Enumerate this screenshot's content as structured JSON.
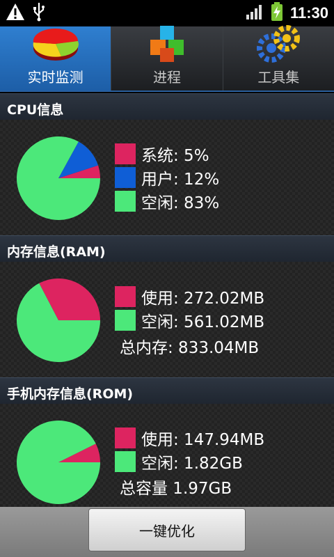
{
  "status_bar": {
    "time": "11:30",
    "icons": [
      "warning-icon",
      "usb-icon",
      "signal-icon",
      "battery-charging-icon"
    ]
  },
  "tabs": [
    {
      "label": "实时监测",
      "icon": "pie-chart-icon",
      "active": true
    },
    {
      "label": "进程",
      "icon": "cubes-icon",
      "active": false
    },
    {
      "label": "工具集",
      "icon": "gears-icon",
      "active": false
    }
  ],
  "cpu": {
    "title": "CPU信息",
    "items": [
      {
        "label": "系统: 5%",
        "color": "#dd2460",
        "value": 5
      },
      {
        "label": "用户: 12%",
        "color": "#0f5ed6",
        "value": 12
      },
      {
        "label": "空闲: 83%",
        "color": "#4ce87a",
        "value": 83
      }
    ]
  },
  "ram": {
    "title": "内存信息(RAM)",
    "items": [
      {
        "label": "使用: 272.02MB",
        "color": "#dd2460",
        "value": 272.02
      },
      {
        "label": "空闲: 561.02MB",
        "color": "#4ce87a",
        "value": 561.02
      }
    ],
    "total": "总内存: 833.04MB"
  },
  "rom": {
    "title": "手机内存信息(ROM)",
    "items": [
      {
        "label": "使用: 147.94MB",
        "color": "#dd2460",
        "value": 147.94
      },
      {
        "label": "空闲: 1.82GB",
        "color": "#4ce87a",
        "value": 1863.68
      }
    ],
    "total": "总容量 1.97GB"
  },
  "button": {
    "label": "一键优化"
  }
}
